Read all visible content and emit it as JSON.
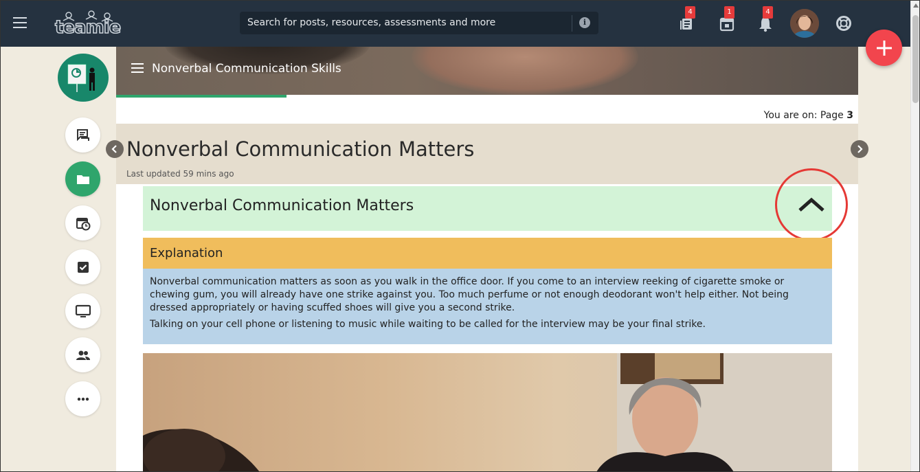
{
  "topbar": {
    "logo_text": "teamie",
    "search_placeholder": "Search for posts, resources, assessments and more",
    "icons": [
      {
        "name": "posts-icon",
        "badge": "4"
      },
      {
        "name": "calendar-icon",
        "badge": "1"
      },
      {
        "name": "bell-icon",
        "badge": "4"
      },
      {
        "name": "help-icon",
        "badge": ""
      }
    ]
  },
  "course": {
    "title": "Nonverbal Communication Skills",
    "progress_fraction": 0.23
  },
  "rail": [
    "discussion-icon",
    "folder-icon",
    "schedule-icon",
    "checkbox-icon",
    "monitor-icon",
    "people-icon",
    "more-icon"
  ],
  "page": {
    "you_are_on_label": "You are on: Page",
    "page_number": "3",
    "title": "Nonverbal Communication Matters",
    "updated": "Last updated 59 mins ago"
  },
  "block": {
    "title": "Nonverbal Communication Matters",
    "explanation_heading": "Explanation",
    "paragraph1": "Nonverbal communication matters as soon as you walk in the office door. If you come to an interview reeking of cigarette smoke or chewing gum, you will already have one strike against you. Too much perfume or not enough deodorant won't help either. Not being dressed appropriately or having scuffed shoes will give you a second strike.",
    "paragraph2": "Talking on your cell phone or listening to music while waiting to be called for the interview may be your final strike."
  },
  "colors": {
    "topbar": "#253240",
    "accent_green": "#2fa56c",
    "fab": "#f2454d",
    "title_block": "#d3f3d7",
    "explanation_head": "#f0bd5c",
    "explanation_body": "#b9d3e8",
    "highlight_circle": "#e53935"
  }
}
